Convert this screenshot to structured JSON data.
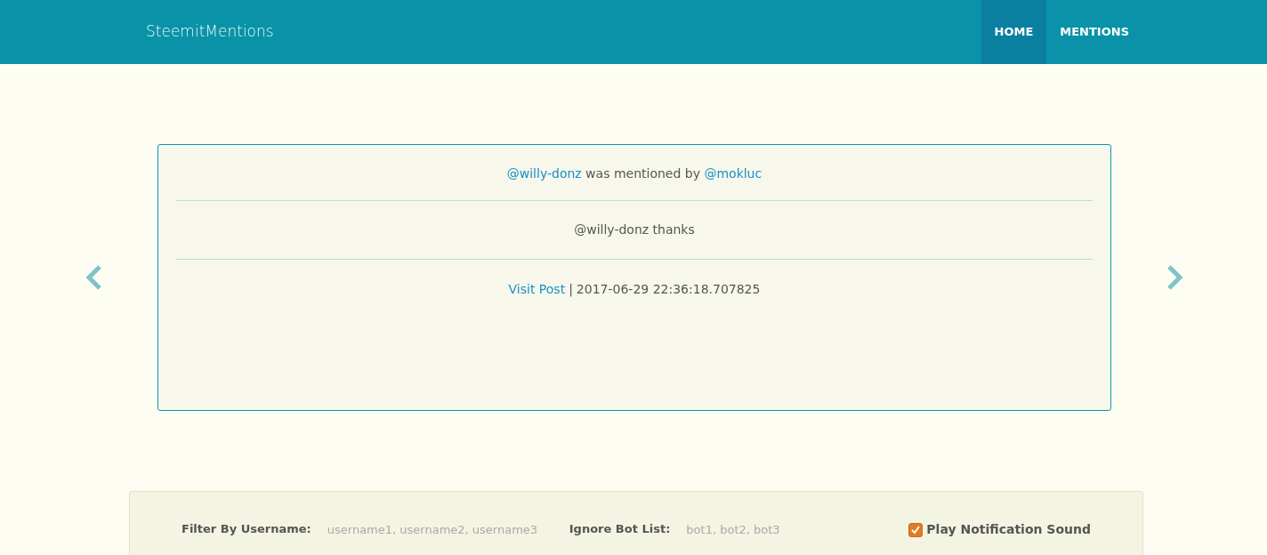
{
  "navbar": {
    "brand": "SteemitMentions",
    "items": [
      {
        "label": "HOME",
        "selected": true
      },
      {
        "label": "MENTIONS",
        "selected": false
      }
    ]
  },
  "mention": {
    "user": "@willy-donz",
    "verb": "was mentioned by",
    "author": "@mokluc",
    "body": "@willy-donz thanks",
    "link": "Visit Post",
    "separator": "|",
    "timestamp": "2017-06-29 22:36:18.707825"
  },
  "filters": {
    "username_label": "Filter By Username:",
    "username_placeholder": "username1, username2, username3",
    "bot_label": "Ignore Bot List:",
    "bot_placeholder": "bot1, bot2, bot3",
    "sound": {
      "label": "Play Notification Sound",
      "checked": true
    }
  }
}
